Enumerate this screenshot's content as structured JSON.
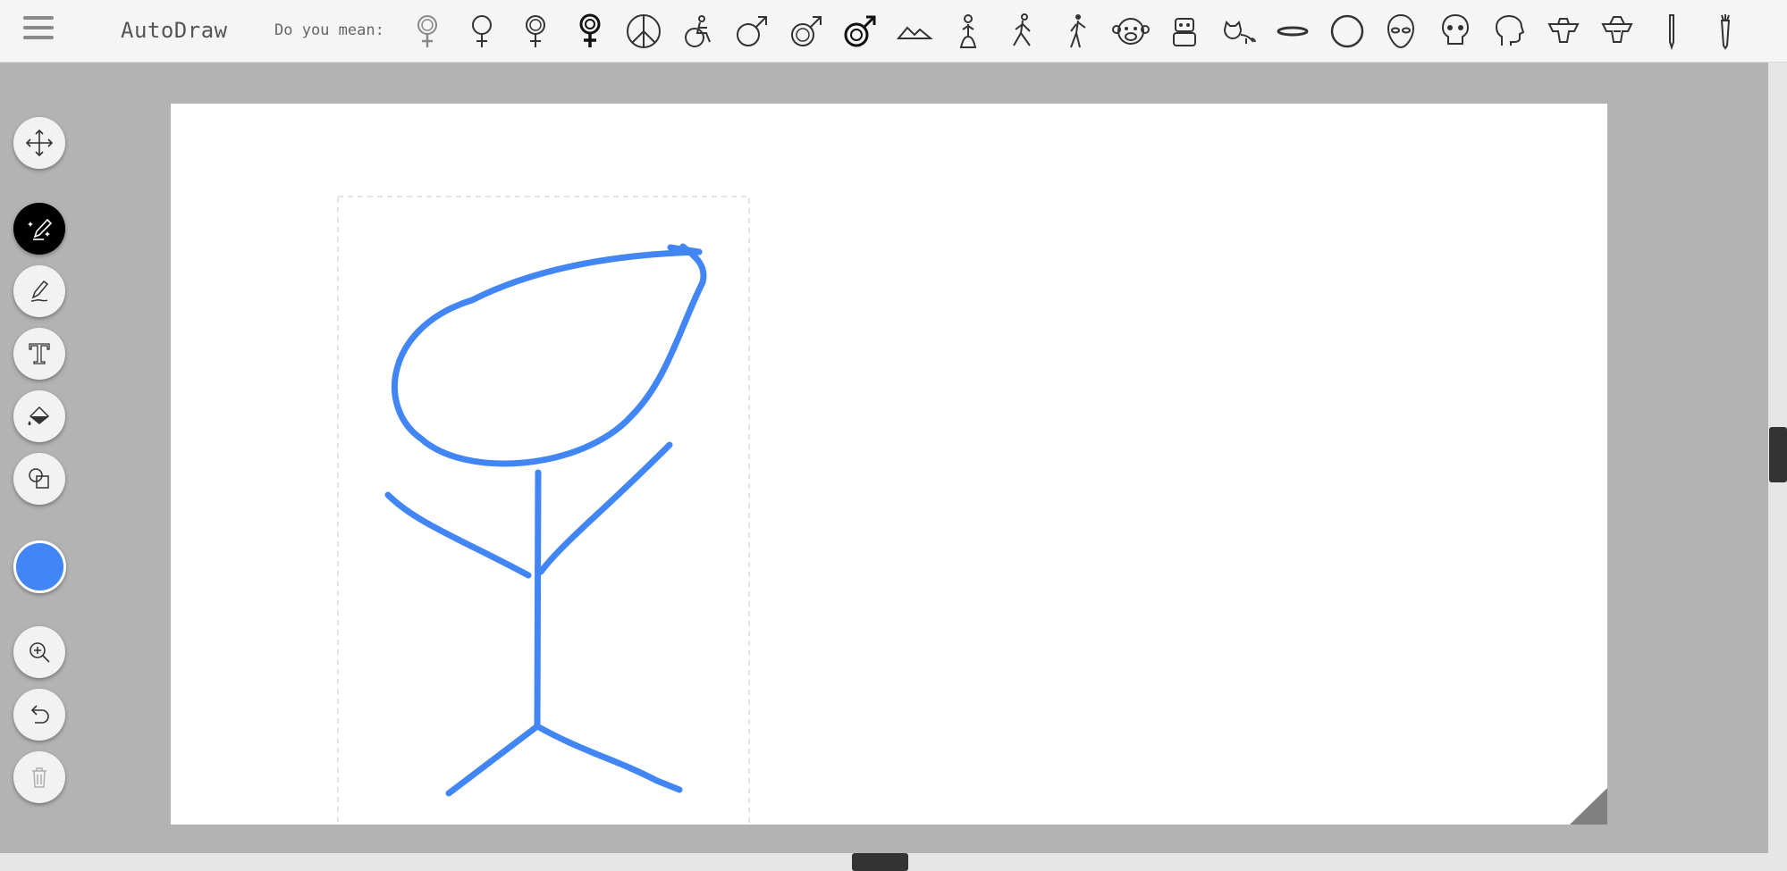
{
  "app": {
    "title": "AutoDraw"
  },
  "suggestions": {
    "label": "Do you mean:",
    "items": [
      "female-symbol-icon",
      "female-symbol-icon",
      "female-symbol-icon",
      "female-symbol-icon",
      "peace-sign-icon",
      "wheelchair-icon",
      "male-symbol-icon",
      "male-symbol-icon",
      "male-symbol-icon",
      "mountain-icon",
      "praying-person-icon",
      "running-person-icon",
      "walking-person-icon",
      "monkey-face-icon",
      "robot-icon",
      "cat-icon",
      "ellipse-icon",
      "circle-icon",
      "alien-head-icon",
      "skull-icon",
      "head-profile-icon",
      "armor-icon",
      "armor-icon",
      "pencil-icon",
      "carrot-icon"
    ]
  },
  "toolbar": {
    "tools": [
      "move-tool",
      "autodraw-tool",
      "draw-tool",
      "type-tool",
      "fill-tool",
      "shape-tool"
    ],
    "active_tool": "autodraw-tool",
    "color": "#4285f4",
    "actions": [
      "zoom-button",
      "undo-button",
      "delete-button"
    ]
  },
  "drawing": {
    "stroke_color": "#4285f4"
  }
}
